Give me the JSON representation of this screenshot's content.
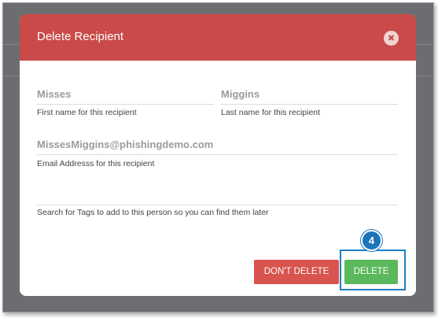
{
  "modal": {
    "title": "Delete Recipient",
    "close_icon": "close-icon",
    "close_glyph": "✖"
  },
  "fields": {
    "first_name": {
      "value": "Misses",
      "help": "First name for this recipient"
    },
    "last_name": {
      "value": "Miggins",
      "help": "Last name for this recipient"
    },
    "email": {
      "value": "MissesMiggins@phishingdemo.com",
      "help": "Email Addresss for this recipient"
    },
    "tags": {
      "value": "",
      "help": "Search for Tags to add to this person so you can find them later"
    }
  },
  "buttons": {
    "dont_delete": "DON'T DELETE",
    "delete": "DELETE"
  },
  "annotation": {
    "step_number": "4",
    "color": "#1b75bb"
  },
  "colors": {
    "header": "#c94a48",
    "danger": "#d9534f",
    "success": "#5cb85c",
    "overlay": "#6b6d70"
  }
}
